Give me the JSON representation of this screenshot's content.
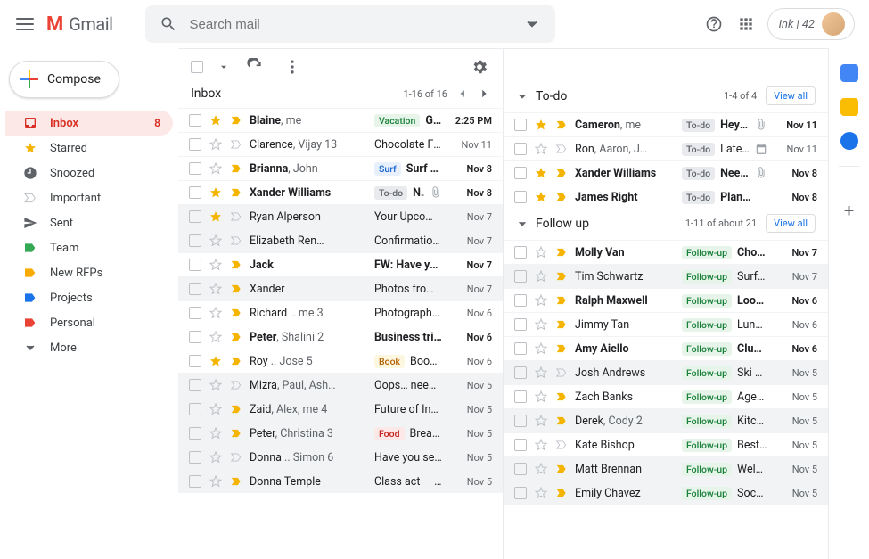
{
  "header": {
    "app_name": "Gmail",
    "search_placeholder": "Search mail",
    "brand_chip": "Ink | 42"
  },
  "nav": {
    "compose": "Compose",
    "items": [
      {
        "label": "Inbox",
        "count": "8",
        "active": true,
        "icon": "inbox"
      },
      {
        "label": "Starred",
        "icon": "star"
      },
      {
        "label": "Snoozed",
        "icon": "clock"
      },
      {
        "label": "Important",
        "icon": "imp"
      },
      {
        "label": "Sent",
        "icon": "sent"
      },
      {
        "label": "Team",
        "icon": "label",
        "color": "#34a853"
      },
      {
        "label": "New RFPs",
        "icon": "label",
        "color": "#f9ab00"
      },
      {
        "label": "Projects",
        "icon": "label",
        "color": "#1a73e8"
      },
      {
        "label": "Personal",
        "icon": "label",
        "color": "#ea4335"
      },
      {
        "label": "More",
        "icon": "more"
      }
    ]
  },
  "inbox": {
    "title": "Inbox",
    "range": "1-16 of 16",
    "rows": [
      {
        "unread": true,
        "star": true,
        "imp": true,
        "sender": "Blaine",
        "extra": ", me",
        "tag": "Vacation",
        "tagcls": "t-vac",
        "subj": "Greece…",
        "date": "2:25 PM"
      },
      {
        "unread": false,
        "star": false,
        "imp": false,
        "sender": "Clarence",
        "extra": ", Vijay 13",
        "subj": "Chocolate Factor…",
        "date": "Nov 11"
      },
      {
        "unread": true,
        "star": false,
        "imp": true,
        "sender": "Brianna",
        "extra": ", John",
        "tag": "Surf",
        "tagcls": "t-surf",
        "subj": "Surf Sunda…",
        "date": "Nov 8"
      },
      {
        "unread": true,
        "star": true,
        "imp": true,
        "sender": "Xander Williams",
        "tag": "To-do",
        "tagcls": "t-todo",
        "subj": "Need…",
        "after": "att",
        "date": "Nov 8"
      },
      {
        "unread": false,
        "sel": true,
        "star": true,
        "imp": false,
        "sender": "Ryan Alperson",
        "subj": "Your Upcoming R…",
        "date": "Nov 7"
      },
      {
        "unread": false,
        "sel": true,
        "star": false,
        "imp": false,
        "sender": "Elizabeth Ren…",
        "subj": "Confirmation for…",
        "date": "Nov 7"
      },
      {
        "unread": true,
        "star": false,
        "imp": true,
        "sender": "Jack",
        "subj": "FW: Have you ev…",
        "date": "Nov 7"
      },
      {
        "unread": false,
        "sel": true,
        "star": false,
        "imp": true,
        "sender": "Xander",
        "subj": "Photos from my r…",
        "date": "Nov 7"
      },
      {
        "unread": false,
        "star": false,
        "imp": true,
        "sender": "Richard",
        "extra": " .. me  3",
        "subj": "Photography clas…",
        "date": "Nov 6"
      },
      {
        "unread": true,
        "star": false,
        "imp": true,
        "sender": "Peter",
        "extra": ", Shalini  2",
        "subj": "Business trip — H…",
        "date": "Nov 6"
      },
      {
        "unread": false,
        "star": true,
        "imp": true,
        "sender": "Roy",
        "extra": " .. Jose  5",
        "tag": "Book",
        "tagcls": "t-book",
        "subj": "Book you r…",
        "date": "Nov 6"
      },
      {
        "unread": false,
        "sel": true,
        "star": false,
        "imp": false,
        "sender": "Mizra",
        "extra": ", Paul, Ash…",
        "subj": "Oops… need to re…",
        "date": "Nov 5"
      },
      {
        "unread": false,
        "sel": true,
        "star": false,
        "imp": true,
        "sender": "Zaid",
        "extra": ", Alex, me  4",
        "subj": "Future of Inbox —…",
        "date": "Nov 5"
      },
      {
        "unread": false,
        "sel": true,
        "star": false,
        "imp": true,
        "sender": "Peter",
        "extra": ", Christina  3",
        "tag": "Food",
        "tagcls": "t-food",
        "subj": "Bread and…",
        "date": "Nov 5"
      },
      {
        "unread": false,
        "sel": true,
        "star": false,
        "imp": false,
        "sender": "Donna",
        "extra": " .. Simon  6",
        "subj": "Have you seen th…",
        "date": "Nov 5"
      },
      {
        "unread": false,
        "sel": true,
        "star": false,
        "imp": true,
        "sender": "Donna Temple",
        "subj": "Class act — Tom…",
        "date": "Nov 5"
      }
    ]
  },
  "sections": [
    {
      "title": "To-do",
      "range": "1-4 of 4",
      "viewall": "View all",
      "collapsed": false,
      "rows": [
        {
          "unread": true,
          "star": true,
          "imp": true,
          "sender": "Cameron",
          "extra": ", me",
          "tag": "To-do",
          "tagcls": "t-todo",
          "subj": "Hey t…",
          "after": "att",
          "date": "Nov 11"
        },
        {
          "unread": false,
          "star": false,
          "imp": false,
          "sender": "Ron",
          "extra": ", Aaron, J…",
          "tag": "To-do",
          "tagcls": "t-todo",
          "subj": "Late…",
          "after": "cal",
          "date": "Nov 11"
        },
        {
          "unread": true,
          "star": true,
          "imp": true,
          "sender": "Xander Williams",
          "tag": "To-do",
          "tagcls": "t-todo",
          "subj": "Need…",
          "after": "att",
          "date": "Nov 8"
        },
        {
          "unread": true,
          "star": true,
          "imp": true,
          "sender": "James Right",
          "tag": "To-do",
          "tagcls": "t-todo",
          "subj": "Plan…",
          "date": "Nov 8"
        }
      ]
    },
    {
      "title": "Follow up",
      "range": "1-11 of about 21",
      "viewall": "View all",
      "collapsed": false,
      "rows": [
        {
          "unread": true,
          "star": false,
          "imp": true,
          "sender": "Molly Van",
          "tag": "Follow-up",
          "tagcls": "t-fu",
          "subj": "Choco…",
          "date": "Nov 7"
        },
        {
          "unread": false,
          "sel": true,
          "star": false,
          "imp": true,
          "sender": "Tim Schwartz",
          "tag": "Follow-up",
          "tagcls": "t-fu",
          "subj": "Surf S…",
          "date": "Nov 7"
        },
        {
          "unread": true,
          "star": false,
          "imp": true,
          "sender": "Ralph Maxwell",
          "tag": "Follow-up",
          "tagcls": "t-fu",
          "subj": "Looki…",
          "date": "Nov 6"
        },
        {
          "unread": false,
          "star": false,
          "imp": true,
          "sender": "Jimmy Tan",
          "tag": "Follow-up",
          "tagcls": "t-fu",
          "subj": "Lunch…",
          "date": "Nov 6"
        },
        {
          "unread": true,
          "star": false,
          "imp": true,
          "sender": "Amy Aiello",
          "tag": "Follow-up",
          "tagcls": "t-fu",
          "subj": "Club…",
          "date": "Nov 6"
        },
        {
          "unread": false,
          "sel": true,
          "star": false,
          "imp": false,
          "sender": "Josh Andrews",
          "tag": "Follow-up",
          "tagcls": "t-fu",
          "subj": "Ski se…",
          "date": "Nov 5"
        },
        {
          "unread": false,
          "star": false,
          "imp": true,
          "sender": "Zach Banks",
          "tag": "Follow-up",
          "tagcls": "t-fu",
          "subj": "Agend…",
          "date": "Nov 5"
        },
        {
          "unread": false,
          "sel": true,
          "star": false,
          "imp": true,
          "sender": "Derek",
          "extra": ", Cody  2",
          "tag": "Follow-up",
          "tagcls": "t-fu",
          "subj": "Kitche…",
          "date": "Nov 5"
        },
        {
          "unread": false,
          "star": false,
          "imp": false,
          "sender": "Kate Bishop",
          "tag": "Follow-up",
          "tagcls": "t-fu",
          "subj": "Best…",
          "date": "Nov 5"
        },
        {
          "unread": false,
          "sel": true,
          "star": false,
          "imp": true,
          "sender": "Matt Brennan",
          "tag": "Follow-up",
          "tagcls": "t-fu",
          "subj": "Welco…",
          "date": "Nov 5"
        },
        {
          "unread": false,
          "sel": true,
          "star": false,
          "imp": true,
          "sender": "Emily Chavez",
          "tag": "Follow-up",
          "tagcls": "t-fu",
          "subj": "Socce…",
          "date": "Nov 5"
        }
      ]
    }
  ]
}
